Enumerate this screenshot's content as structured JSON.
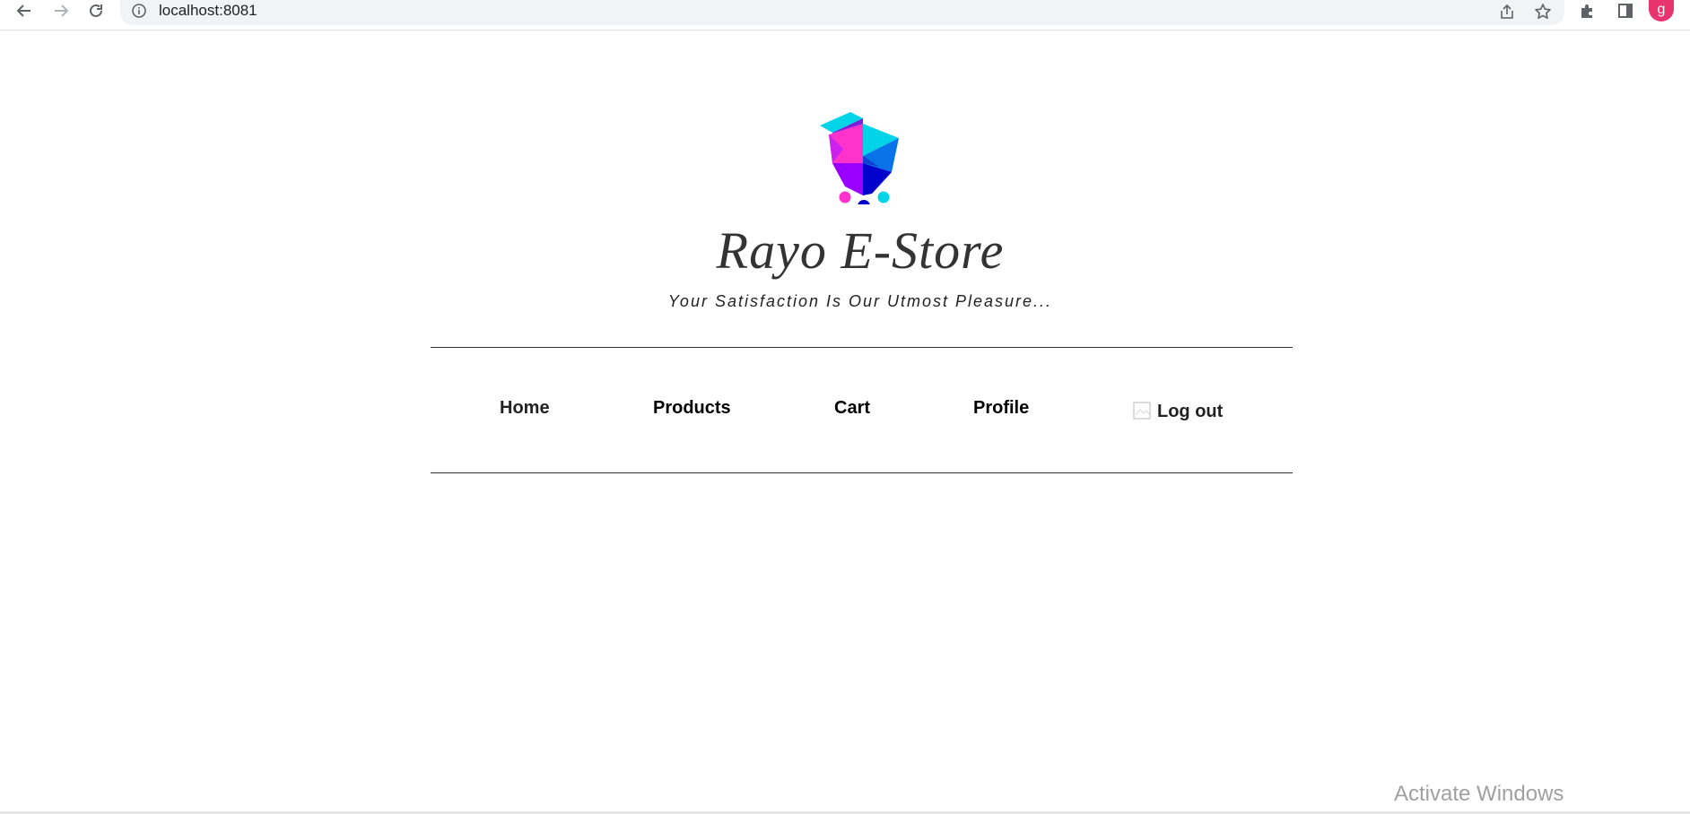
{
  "browser": {
    "url": "localhost:8081",
    "avatar_letter": "g",
    "icons": {
      "back": "back-arrow-icon",
      "forward": "forward-arrow-icon",
      "reload": "reload-icon",
      "site_info": "info-icon",
      "share": "share-icon",
      "bookmark": "star-icon",
      "extensions": "puzzle-icon",
      "side_panel": "side-panel-icon"
    },
    "avatar_color": "#e8336f"
  },
  "site": {
    "title": "Rayo E-Store",
    "tagline": "Your Satisfaction Is Our Utmost Pleasure...",
    "logo": "shopping-cart-logo",
    "logo_colors": [
      "#00d4e6",
      "#ff33cc",
      "#9900ff",
      "#0066ff",
      "#0000cc"
    ]
  },
  "nav": {
    "home": "Home",
    "products": "Products",
    "cart": "Cart",
    "profile": "Profile",
    "logout": "Log out"
  },
  "system": {
    "watermark": "Activate Windows"
  }
}
